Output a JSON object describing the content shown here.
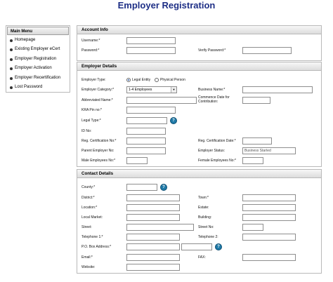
{
  "page": {
    "title": "Employer Registration"
  },
  "menu": {
    "header": "Main Menu",
    "items": [
      "Homepage",
      "Existing Employer eCert",
      "Employer Registration",
      "Employer Activation",
      "Employer Recertification",
      "Lost Password"
    ]
  },
  "account": {
    "header": "Account Info",
    "username_label": "Username:*",
    "password_label": "Password:*",
    "verify_label": "Verify Password:*"
  },
  "employer": {
    "header": "Employer Details",
    "type_label": "Employer Type:",
    "type_options": [
      "Legal Entity",
      "Physical Person"
    ],
    "category_label": "Employer Category:*",
    "category_value": "1-4 Employees",
    "business_name_label": "Business Name:*",
    "abbrev_label": "Abbreviated Name:*",
    "commence_label": "Commence Date for Contribution:",
    "kra_label": "KRA Pin no:*",
    "legal_type_label": "Legal Type:*",
    "id_label": "ID No:",
    "reg_cert_no_label": "Reg. Certification No:*",
    "reg_cert_date_label": "Reg. Certification Date:*",
    "parent_label": "Parent Employer No:",
    "status_label": "Employer Status:",
    "status_value": "Business Started",
    "male_label": "Male Employees No:*",
    "female_label": "Female Employees No:*"
  },
  "contact": {
    "header": "Contact Details",
    "county_label": "County:*",
    "district_label": "District:*",
    "town_label": "Town:*",
    "location_label": "Location:*",
    "estate_label": "Estate:",
    "local_market_label": "Local Market:",
    "building_label": "Building:",
    "street_label": "Street:",
    "street_no_label": "Street No:",
    "tel1_label": "Telephone 1:*",
    "tel2_label": "Telephone 2:",
    "po_label": "P.O. Box Address:*",
    "email_label": "Email:*",
    "fax_label": "FAX:",
    "website_label": "Website:"
  }
}
